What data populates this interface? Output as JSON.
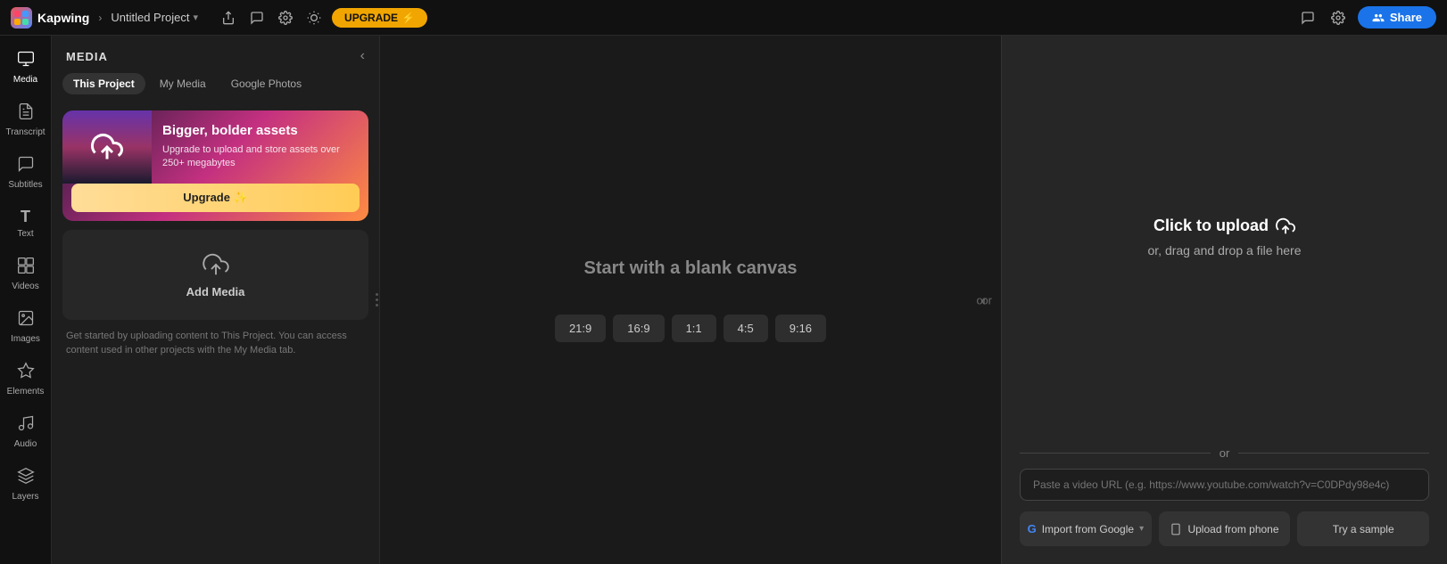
{
  "topbar": {
    "brand": "Kapwing",
    "project_name": "Untitled Project",
    "upgrade_label": "UPGRADE",
    "share_label": "Share"
  },
  "left_nav": {
    "items": [
      {
        "id": "media",
        "icon": "🎞",
        "label": "Media",
        "active": true
      },
      {
        "id": "transcript",
        "icon": "≡",
        "label": "Transcript",
        "active": false
      },
      {
        "id": "subtitles",
        "icon": "💬",
        "label": "Subtitles",
        "active": false
      },
      {
        "id": "text",
        "icon": "T",
        "label": "Text",
        "active": false
      },
      {
        "id": "videos",
        "icon": "▦",
        "label": "Videos",
        "active": false
      },
      {
        "id": "images",
        "icon": "🖼",
        "label": "Images",
        "active": false
      },
      {
        "id": "elements",
        "icon": "✦",
        "label": "Elements",
        "active": false
      },
      {
        "id": "audio",
        "icon": "♪",
        "label": "Audio",
        "active": false
      },
      {
        "id": "layers",
        "icon": "⧉",
        "label": "Layers",
        "active": false
      }
    ]
  },
  "sidebar": {
    "title": "MEDIA",
    "tabs": [
      {
        "label": "This Project",
        "active": true
      },
      {
        "label": "My Media",
        "active": false
      },
      {
        "label": "Google Photos",
        "active": false
      }
    ],
    "upgrade_card": {
      "title": "Bigger, bolder assets",
      "description": "Upgrade to upload and store assets over 250+ megabytes",
      "button_label": "Upgrade ✨"
    },
    "add_media": {
      "label": "Add Media"
    },
    "hint": "Get started by uploading content to This Project. You can access content used in other projects with the My Media tab."
  },
  "canvas": {
    "blank_label": "Start with a blank canvas",
    "or_label": "or",
    "aspect_ratios": [
      {
        "label": "21:9"
      },
      {
        "label": "16:9"
      },
      {
        "label": "1:1"
      },
      {
        "label": "4:5"
      },
      {
        "label": "9:16"
      }
    ]
  },
  "upload_panel": {
    "title": "Click to upload",
    "subtitle": "or, drag and drop a file here",
    "url_placeholder": "Paste a video URL (e.g. https://www.youtube.com/watch?v=C0DPdy98e4c)",
    "actions": [
      {
        "id": "import-google",
        "icon": "G",
        "label": "Import from Google"
      },
      {
        "id": "upload-phone",
        "icon": "📱",
        "label": "Upload from phone"
      },
      {
        "id": "try-sample",
        "icon": "",
        "label": "Try a sample"
      }
    ]
  }
}
